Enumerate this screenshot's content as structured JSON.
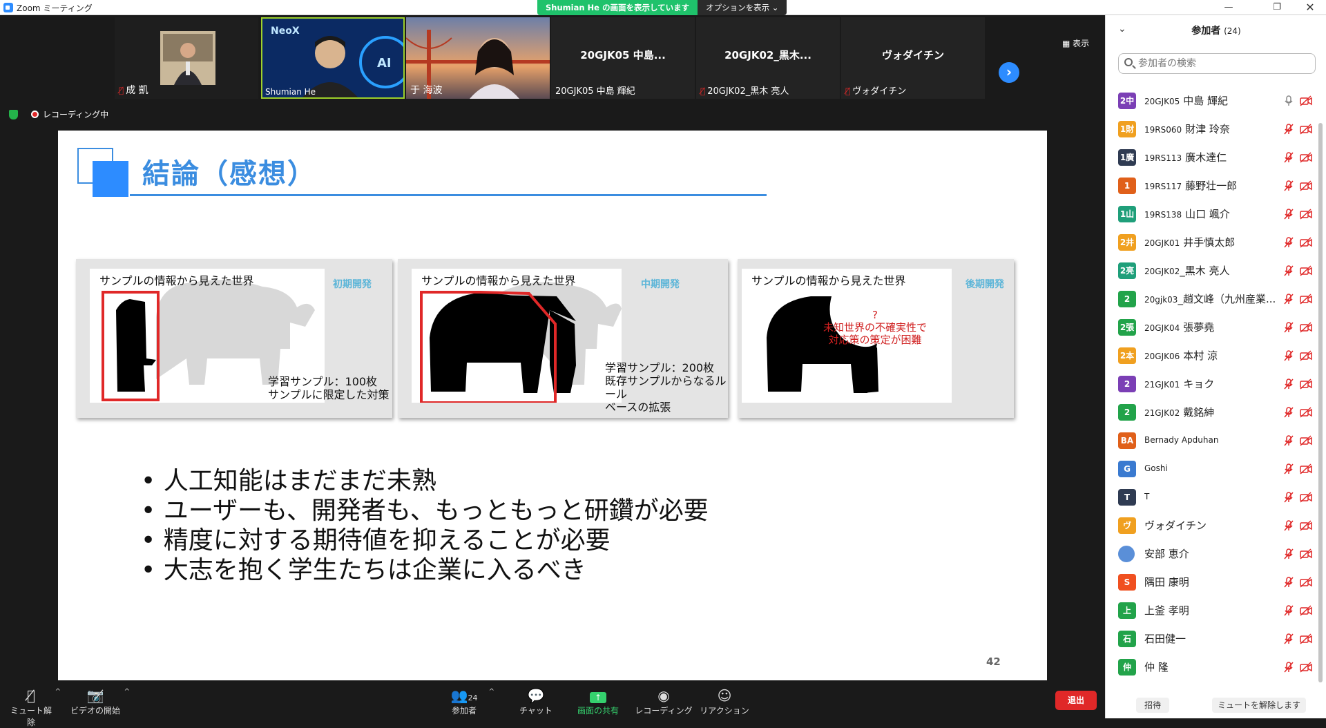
{
  "window": {
    "title": "Zoom ミーティング"
  },
  "share_banner": {
    "status": "Shumian  He の画面を表示しています",
    "options": "オプションを表示 ⌄"
  },
  "video_strip": {
    "tiles": [
      {
        "name": "成 凱",
        "muted": true
      },
      {
        "name": "Shumian He",
        "muted": false,
        "active": true
      },
      {
        "name": "于 海波",
        "muted": false
      },
      {
        "name": "20GJK05 中島 輝紀",
        "display": "20GJK05 中島...",
        "muted": false
      },
      {
        "name": "20GJK02_黒木 亮人",
        "display": "20GJK02_黒木...",
        "muted": true
      },
      {
        "name": "ヴォダイチン",
        "display": "ヴォダイチン",
        "muted": true
      }
    ],
    "view_label": "表示"
  },
  "recording": {
    "label": "レコーディング中"
  },
  "slide": {
    "title": "結論（感想）",
    "panels": [
      {
        "heading": "サンプルの情報から見えた世界",
        "phase": "初期開発",
        "note": [
          "学習サンプル：100枚",
          "サンプルに限定した対策"
        ]
      },
      {
        "heading": "サンプルの情報から見えた世界",
        "phase": "中期開発",
        "note": [
          "学習サンプル：200枚",
          "既存サンプルからなるルール",
          "ベースの拡張"
        ]
      },
      {
        "heading": "サンプルの情報から見えた世界",
        "phase": "後期開発",
        "note": [
          "?",
          "未知世界の不確実性で",
          "対応策の策定が困難"
        ]
      }
    ],
    "bullets": [
      "人工知能はまだまだ未熟",
      "ユーザーも、開発者も、もっともっと研鑽が必要",
      "精度に対する期待値を抑えることが必要",
      "大志を抱く学生たちは企業に入るべき"
    ],
    "page_number": "42"
  },
  "toolbar": {
    "mute": "ミュート解除",
    "video": "ビデオの開始",
    "participants": "参加者",
    "participants_count": "24",
    "chat": "チャット",
    "share": "画面の共有",
    "record": "レコーディング",
    "reactions": "リアクション",
    "leave": "退出"
  },
  "participants_panel": {
    "title": "参加者",
    "count": "(24)",
    "search_placeholder": "参加者の検索",
    "participants": [
      {
        "avatar": "2中",
        "color": "#7b3fb5",
        "prefix": "20GJK05",
        "name": "中島 輝紀",
        "mic": "on"
      },
      {
        "avatar": "1財",
        "color": "#f0a020",
        "prefix": "19RS060",
        "name": "財津 玲奈",
        "mic": "off"
      },
      {
        "avatar": "1廣",
        "color": "#2f3b52",
        "prefix": "19RS113",
        "name": "廣木達仁",
        "mic": "off"
      },
      {
        "avatar": "1",
        "color": "#e0601a",
        "prefix": "19RS117",
        "name": "藤野壮一郎",
        "mic": "off"
      },
      {
        "avatar": "1山",
        "color": "#1f9f7a",
        "prefix": "19RS138",
        "name": "山口 颯介",
        "mic": "off"
      },
      {
        "avatar": "2井",
        "color": "#f0a020",
        "prefix": "20GJK01",
        "name": "井手慎太郎",
        "mic": "off"
      },
      {
        "avatar": "2亮",
        "color": "#1f9f7a",
        "prefix": "20GJK02",
        "name": "_黒木 亮人",
        "mic": "off"
      },
      {
        "avatar": "2",
        "color": "#22a34a",
        "prefix": "20gjk03",
        "name": "_趙文峰（九州産業...",
        "mic": "off"
      },
      {
        "avatar": "2張",
        "color": "#22a34a",
        "prefix": "20GJK04",
        "name": "張夢堯",
        "mic": "off"
      },
      {
        "avatar": "2本",
        "color": "#f0a020",
        "prefix": "20GJK06",
        "name": "本村 涼",
        "mic": "off"
      },
      {
        "avatar": "2",
        "color": "#7b3fb5",
        "prefix": "21GJK01",
        "name": "キョク",
        "mic": "off"
      },
      {
        "avatar": "2",
        "color": "#22a34a",
        "prefix": "21GJK02",
        "name": "戴銘紳",
        "mic": "off"
      },
      {
        "avatar": "BA",
        "color": "#e0601a",
        "prefix": "",
        "name": "Bernady Apduhan",
        "small": true,
        "mic": "off"
      },
      {
        "avatar": "G",
        "color": "#3a7ad0",
        "prefix": "",
        "name": "Goshi",
        "small": true,
        "mic": "off"
      },
      {
        "avatar": "T",
        "color": "#2f3b52",
        "prefix": "",
        "name": "T",
        "small": true,
        "mic": "off"
      },
      {
        "avatar": "ヴ",
        "color": "#f0a020",
        "prefix": "",
        "name": "ヴォダイチン",
        "mic": "off"
      },
      {
        "avatar": "",
        "color": "#5a8fd8",
        "prefix": "",
        "name": "安部 恵介",
        "person": true,
        "mic": "off"
      },
      {
        "avatar": "S",
        "color": "#f05020",
        "prefix": "",
        "name": "隅田 康明",
        "mic": "off"
      },
      {
        "avatar": "上",
        "color": "#22a34a",
        "prefix": "",
        "name": "上釜 孝明",
        "mic": "off"
      },
      {
        "avatar": "石",
        "color": "#22a34a",
        "prefix": "",
        "name": "石田健一",
        "mic": "off"
      },
      {
        "avatar": "仲",
        "color": "#22a34a",
        "prefix": "",
        "name": "仲 隆",
        "mic": "off"
      }
    ],
    "invite_label": "招待",
    "unmute_all_label": "ミュートを解除します"
  }
}
